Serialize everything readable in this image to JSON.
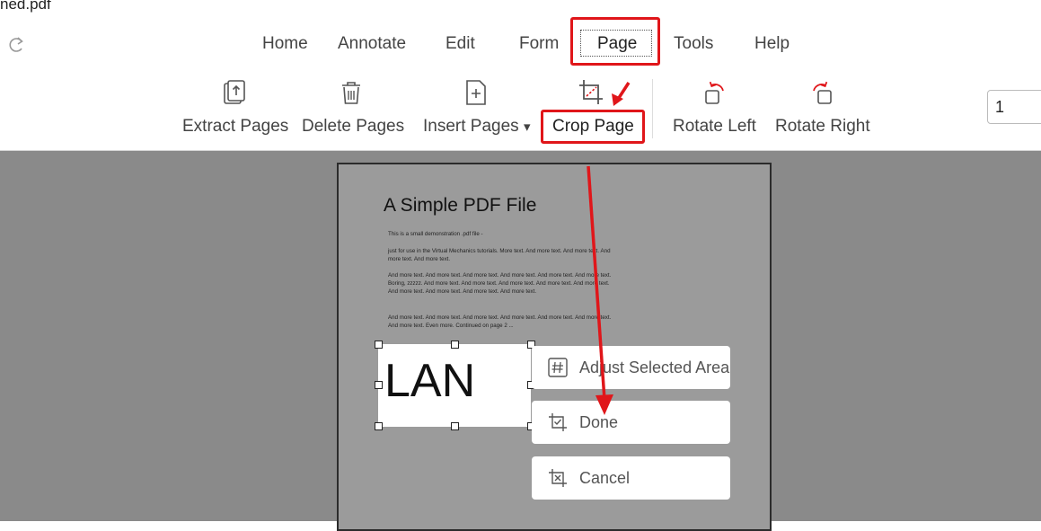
{
  "window": {
    "file_title": "ned.pdf"
  },
  "menu": {
    "items": [
      {
        "label": "Home"
      },
      {
        "label": "Annotate"
      },
      {
        "label": "Edit"
      },
      {
        "label": "Form"
      },
      {
        "label": "Page",
        "active": true
      },
      {
        "label": "Tools"
      },
      {
        "label": "Help"
      }
    ]
  },
  "toolbar": {
    "tools": [
      {
        "label": "Extract Pages",
        "icon": "extract-pages-icon"
      },
      {
        "label": "Delete Pages",
        "icon": "trash-icon"
      },
      {
        "label": "Insert Pages",
        "icon": "insert-page-icon",
        "dropdown": "▾"
      },
      {
        "label": "Crop Page",
        "icon": "crop-icon"
      },
      {
        "label": "Rotate Left",
        "icon": "rotate-left-icon"
      },
      {
        "label": "Rotate Right",
        "icon": "rotate-right-icon"
      }
    ],
    "page_number": "1"
  },
  "document": {
    "title": "A Simple PDF File",
    "paragraphs": [
      "This is a small demonstration .pdf file -",
      "just for use in the Virtual Mechanics tutorials. More text. And more text. And more text. And more text. And more text.",
      "And more text. And more text. And more text. And more text. And more text. And more text. Boring, zzzzz. And more text. And more text. And more text. And more text. And more text. And more text. And more text. And more text. And more text.",
      "And more text. And more text. And more text. And more text. And more text. And more text. And more text. Even more. Continued on page 2 ..."
    ],
    "crop_selection_text": "LAN"
  },
  "crop_menu": {
    "items": [
      {
        "label": "Adjust Selected Area",
        "icon": "hash-icon"
      },
      {
        "label": "Done",
        "icon": "check-box-icon"
      },
      {
        "label": "Cancel",
        "icon": "x-box-icon"
      }
    ]
  },
  "colors": {
    "highlight": "#e0161a",
    "workspace": "#8a8a8a",
    "page": "#9b9b9b"
  }
}
